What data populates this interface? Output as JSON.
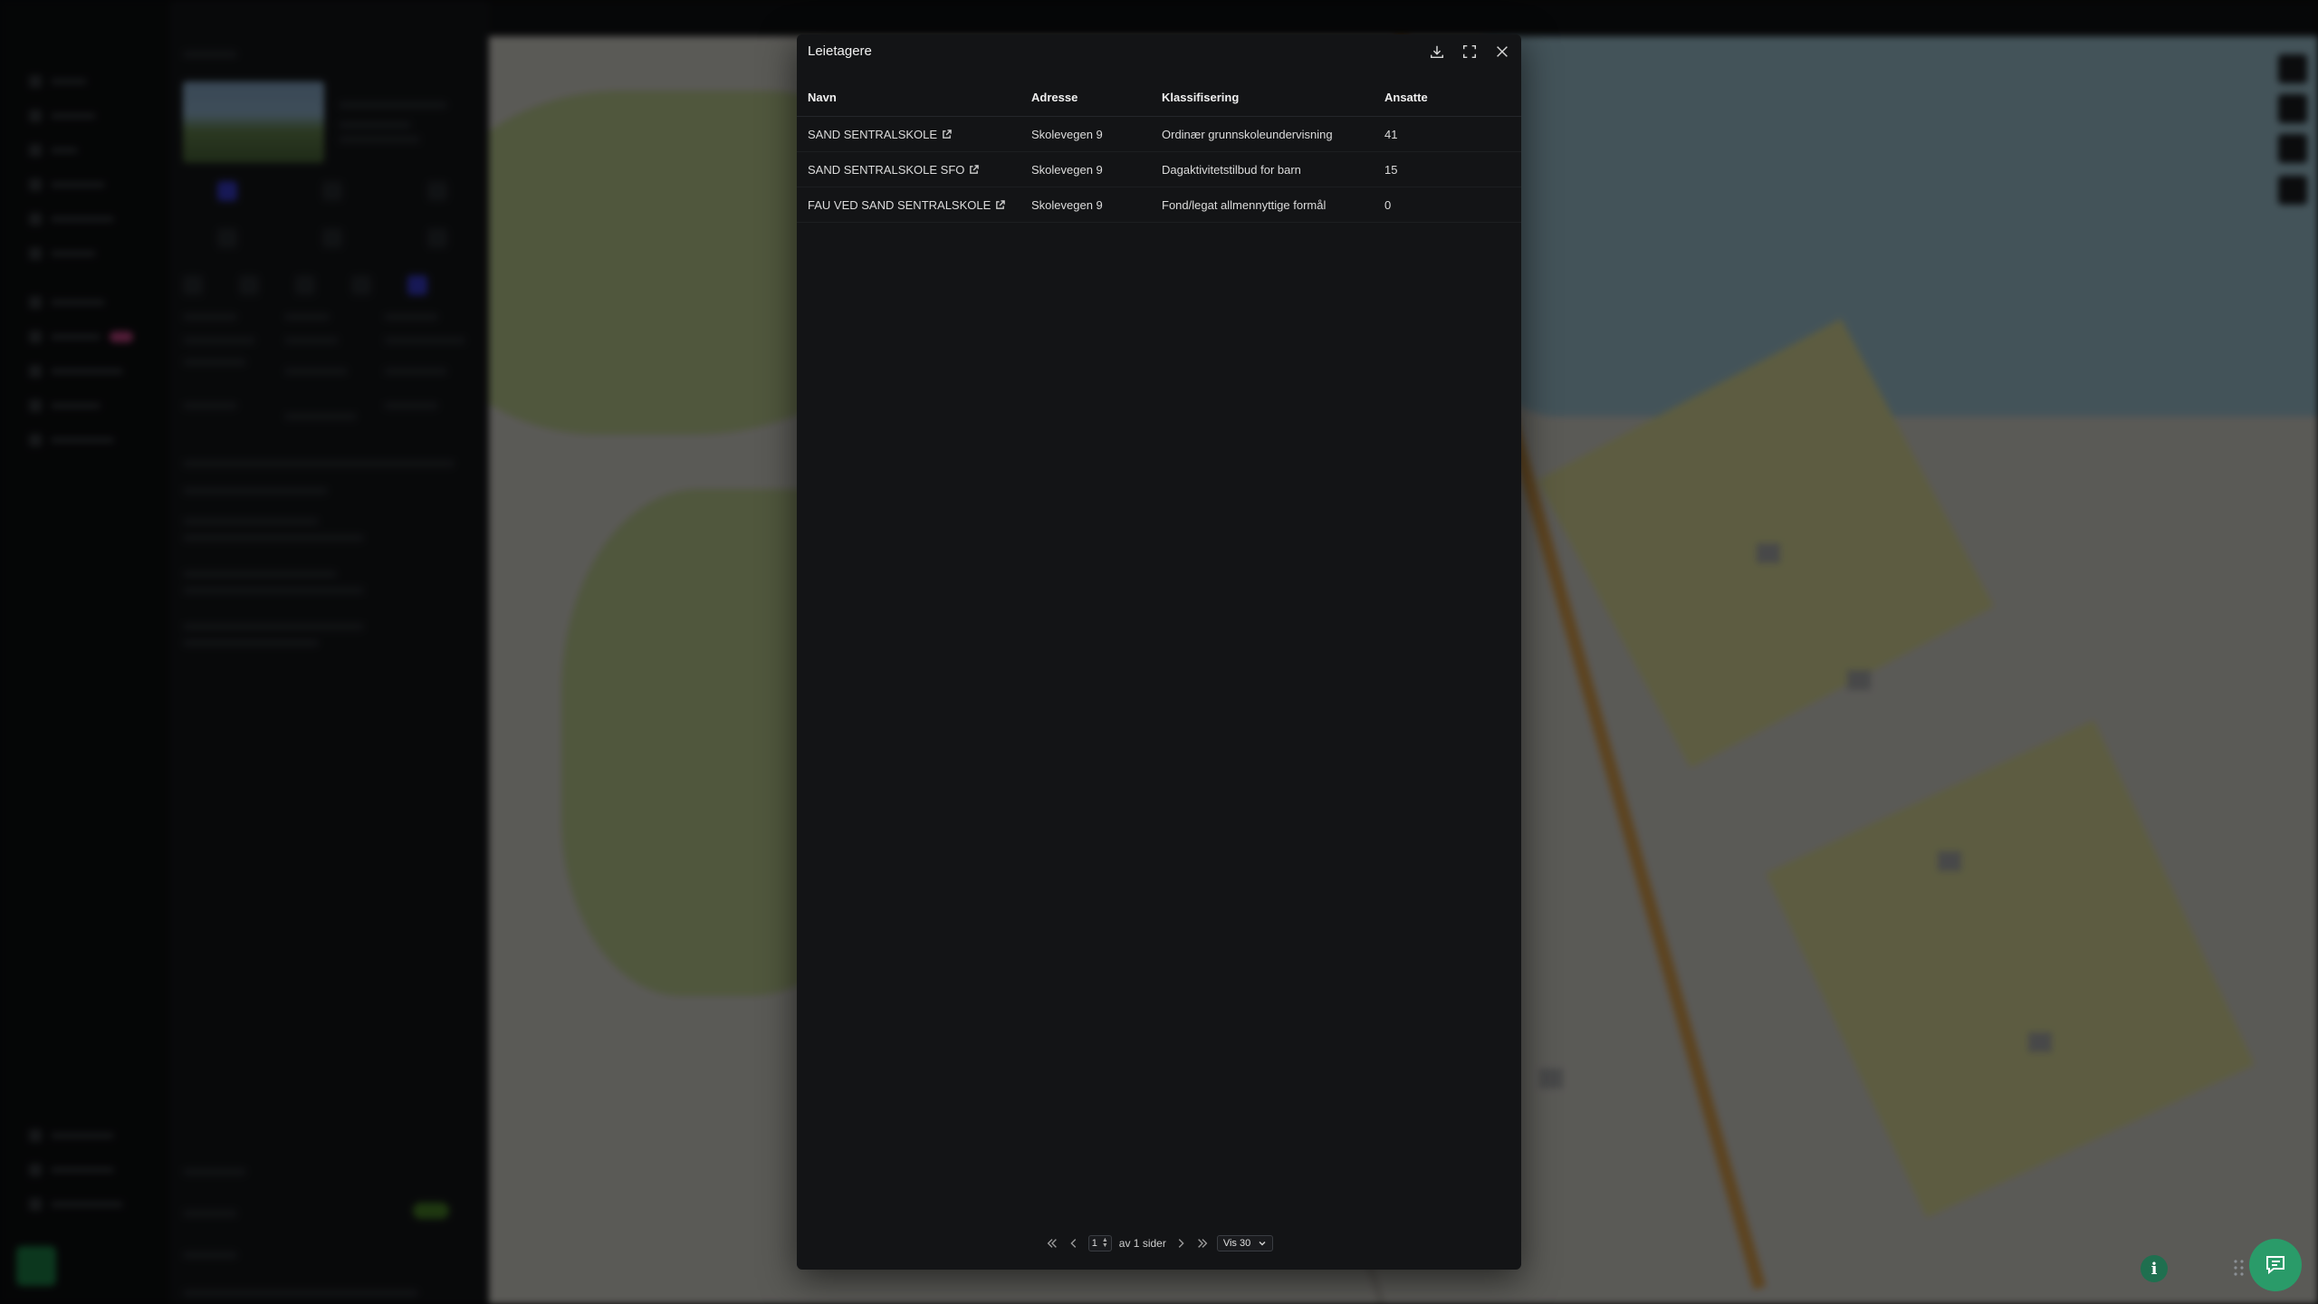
{
  "modal": {
    "title": "Leietagere",
    "columns": [
      "Navn",
      "Adresse",
      "Klassifisering",
      "Ansatte"
    ],
    "rows": [
      {
        "name": "SAND SENTRALSKOLE",
        "address": "Skolevegen 9",
        "classification": "Ordinær grunnskoleundervisning",
        "employees": "41"
      },
      {
        "name": "SAND SENTRALSKOLE SFO",
        "address": "Skolevegen 9",
        "classification": "Dagaktivitetstilbud for barn",
        "employees": "15"
      },
      {
        "name": "FAU VED SAND SENTRALSKOLE",
        "address": "Skolevegen 9",
        "classification": "Fond/legat allmennyttige formål",
        "employees": "0"
      }
    ],
    "actions": {
      "download_icon": "download-icon",
      "expand_icon": "expand-icon",
      "close_icon": "close-icon"
    }
  },
  "pagination": {
    "page": "1",
    "of_pages": "av 1 sider",
    "page_size": "Vis 30"
  },
  "floating": {
    "info_label": "i",
    "chat_icon": "chat-icon"
  },
  "colors": {
    "modal_bg": "#131416",
    "accent_green": "#2a9b69"
  }
}
